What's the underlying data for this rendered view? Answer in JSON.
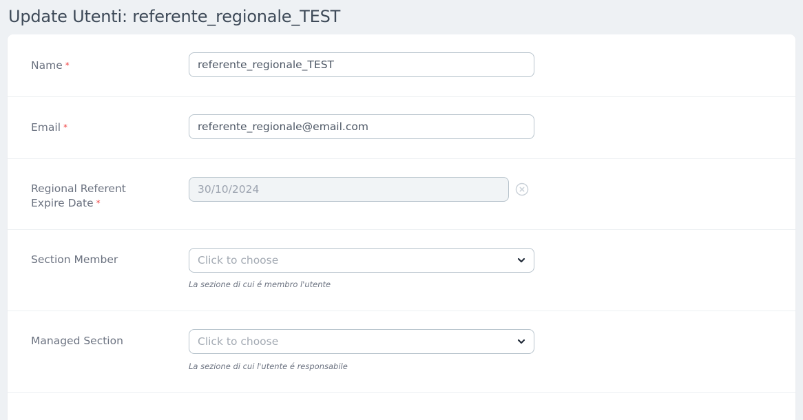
{
  "page": {
    "title": "Update Utenti: referente_regionale_TEST"
  },
  "form": {
    "required_marker": "*",
    "name": {
      "label": "Name",
      "value": "referente_regionale_TEST"
    },
    "email": {
      "label": "Email",
      "value": "referente_regionale@email.com"
    },
    "expire_date": {
      "label_line1": "Regional Referent",
      "label_line2": "Expire Date",
      "value": "30/10/2024",
      "clear_icon": "circle-x-icon"
    },
    "section_member": {
      "label": "Section Member",
      "placeholder": "Click to choose",
      "help": "La sezione di cui é membro l'utente",
      "icon": "chevron-down-icon"
    },
    "managed_section": {
      "label": "Managed Section",
      "placeholder": "Click to choose",
      "help": "La sezione di cui l'utente é responsabile",
      "icon": "chevron-down-icon"
    }
  },
  "colors": {
    "background": "#eef1f4",
    "card": "#ffffff",
    "required": "#ef4444",
    "border": "#b7c3cc"
  }
}
